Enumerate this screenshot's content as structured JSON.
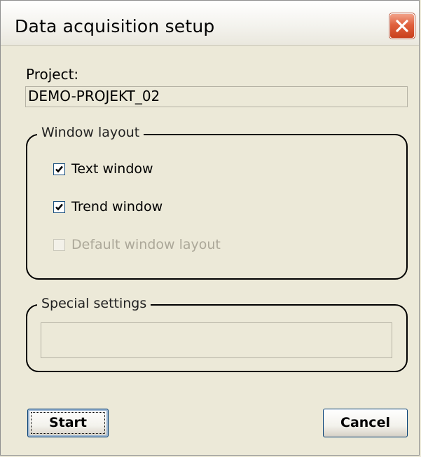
{
  "window": {
    "title": "Data acquisition setup",
    "close_icon": "close-icon"
  },
  "project": {
    "label": "Project:",
    "value": "DEMO-PROJEKT_02"
  },
  "window_layout": {
    "legend": "Window layout",
    "options": [
      {
        "label": "Text window",
        "checked": true,
        "enabled": true
      },
      {
        "label": "Trend window",
        "checked": true,
        "enabled": true
      },
      {
        "label": "Default window layout",
        "checked": false,
        "enabled": false
      }
    ]
  },
  "special_settings": {
    "legend": "Special settings"
  },
  "buttons": {
    "start": "Start",
    "cancel": "Cancel"
  },
  "colors": {
    "dialog_background": "#ECE9D8",
    "close_button": "#E0613E",
    "disabled_text": "#ACA899"
  }
}
